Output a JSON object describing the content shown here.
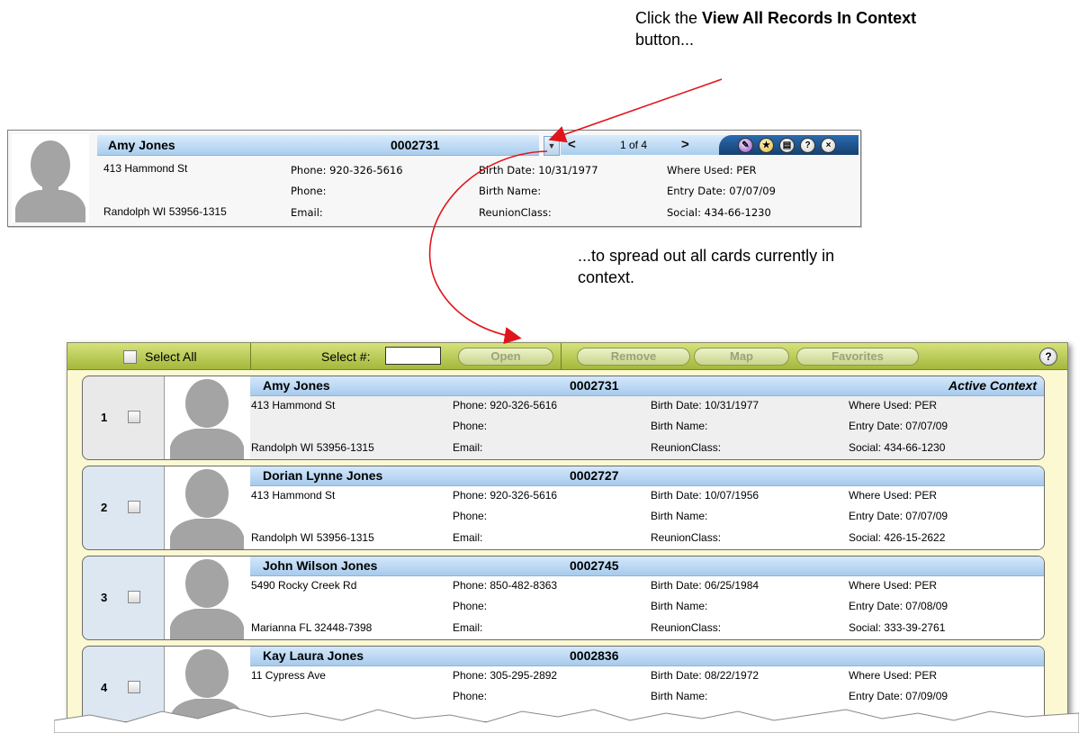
{
  "callouts": {
    "top_prefix": "Click the ",
    "top_bold": "View All Records In Context",
    "top_suffix": " button...",
    "middle": "...to spread out all cards currently in context."
  },
  "single_card": {
    "name": "Amy Jones",
    "id": "0002731",
    "address1": "413 Hammond St",
    "address2": "Randolph WI 53956-1315",
    "phone1": "Phone: 920-326-5616",
    "phone2": "Phone:",
    "email": "Email:",
    "birth_date": "Birth Date: 10/31/1977",
    "birth_name": "Birth Name:",
    "reunion_class": "ReunionClass:",
    "where_used": "Where Used: PER",
    "entry_date": "Entry Date: 07/07/09",
    "social": "Social: 434-66-1230",
    "nav": {
      "prev": "<",
      "counter": "1 of 4",
      "next": ">",
      "dropdown": "▼"
    },
    "icons": [
      "tag-icon",
      "favorite-star-icon",
      "view-all-records-icon",
      "help-icon",
      "close-icon"
    ]
  },
  "context_panel": {
    "toolbar": {
      "select_all": "Select All",
      "select_num": "Select #:",
      "select_num_value": "",
      "open": "Open",
      "remove": "Remove",
      "map": "Map",
      "favorites": "Favorites",
      "help": "?"
    },
    "records": [
      {
        "index": "1",
        "name": "Amy Jones",
        "id": "0002731",
        "context": "Active Context",
        "address1": "413 Hammond St",
        "address2": "Randolph WI 53956-1315",
        "phone1": "Phone: 920-326-5616",
        "phone2": "Phone:",
        "email": "Email:",
        "birth_date": "Birth Date: 10/31/1977",
        "birth_name": "Birth Name:",
        "reunion_class": "ReunionClass:",
        "where_used": "Where Used: PER",
        "entry_date": "Entry Date: 07/07/09",
        "social": "Social: 434-66-1230"
      },
      {
        "index": "2",
        "name": "Dorian Lynne Jones",
        "id": "0002727",
        "context": "",
        "address1": "413 Hammond St",
        "address2": "Randolph WI 53956-1315",
        "phone1": "Phone: 920-326-5616",
        "phone2": "Phone:",
        "email": "Email:",
        "birth_date": "Birth Date: 10/07/1956",
        "birth_name": "Birth Name:",
        "reunion_class": "ReunionClass:",
        "where_used": "Where Used: PER",
        "entry_date": "Entry Date: 07/07/09",
        "social": "Social: 426-15-2622"
      },
      {
        "index": "3",
        "name": "John Wilson Jones",
        "id": "0002745",
        "context": "",
        "address1": "5490 Rocky Creek Rd",
        "address2": "Marianna FL 32448-7398",
        "phone1": "Phone: 850-482-8363",
        "phone2": "Phone:",
        "email": "Email:",
        "birth_date": "Birth Date: 06/25/1984",
        "birth_name": "Birth Name:",
        "reunion_class": "ReunionClass:",
        "where_used": "Where Used: PER",
        "entry_date": "Entry Date: 07/08/09",
        "social": "Social: 333-39-2761"
      },
      {
        "index": "4",
        "name": "Kay Laura Jones",
        "id": "0002836",
        "context": "",
        "address1": "11 Cypress Ave",
        "address2": "",
        "phone1": "Phone: 305-295-2892",
        "phone2": "Phone:",
        "email": "",
        "birth_date": "Birth Date: 08/22/1972",
        "birth_name": "Birth Name:",
        "reunion_class": "",
        "where_used": "Where Used: PER",
        "entry_date": "Entry Date: 07/09/09",
        "social": ""
      }
    ]
  },
  "colors": {
    "arrow": "#e0151b",
    "header_blue": "#a9cdee",
    "toolbar_green": "#a4b83b",
    "panel_yellow": "#fbf8d2",
    "nav_dark_blue": "#16406f"
  }
}
